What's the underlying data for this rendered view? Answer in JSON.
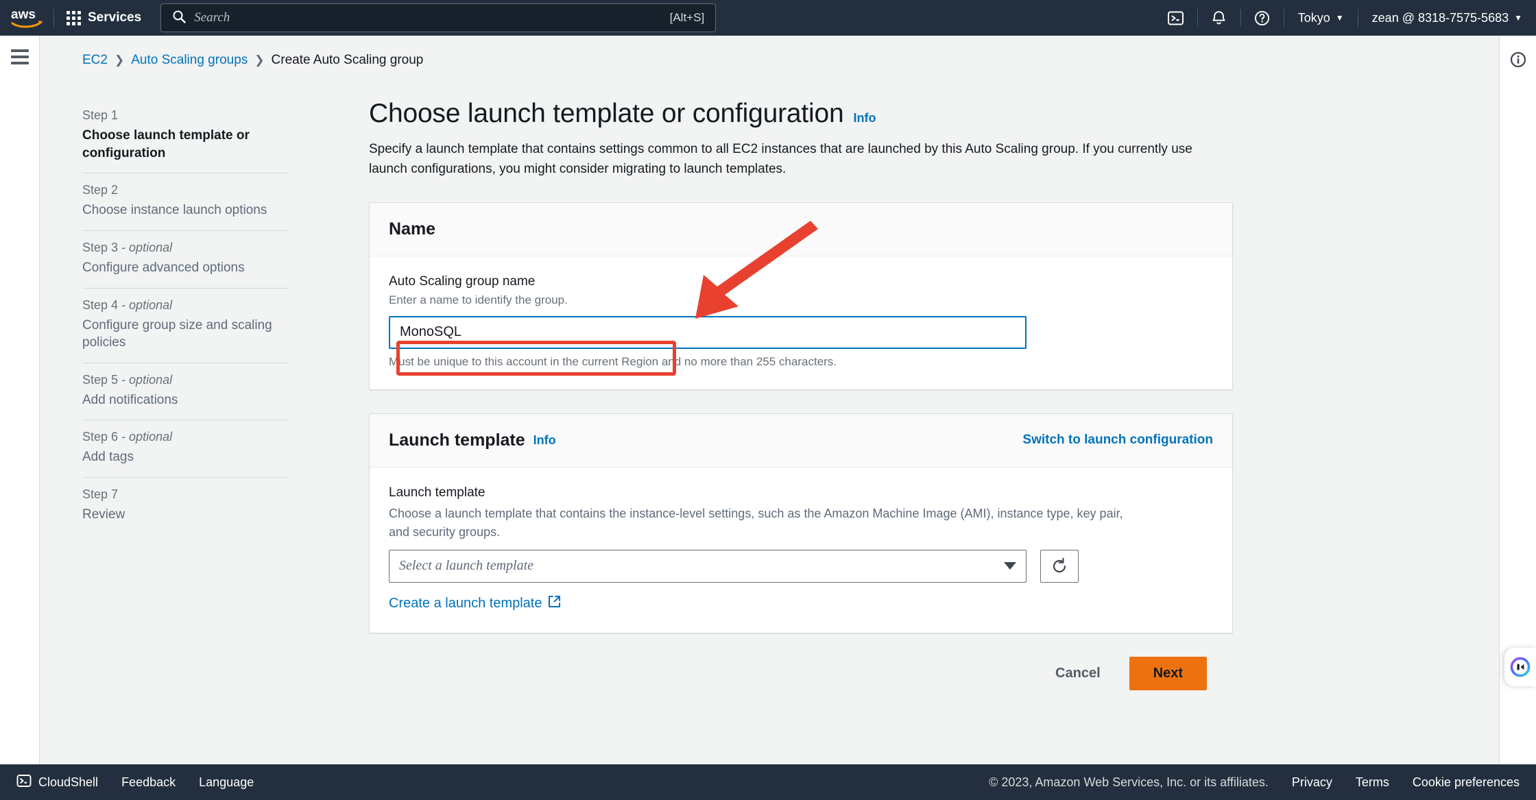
{
  "topnav": {
    "logo_alt": "aws",
    "services_label": "Services",
    "search_placeholder": "Search",
    "search_shortcut": "[Alt+S]",
    "cloudshell_icon": "cloudshell-icon",
    "bell_icon": "notifications-icon",
    "help_icon": "help-icon",
    "region_label": "Tokyo",
    "account_label": "zean @ 8318-7575-5683",
    "caret": "▼"
  },
  "breadcrumb": {
    "items": [
      {
        "label": "EC2",
        "link": true
      },
      {
        "label": "Auto Scaling groups",
        "link": true
      },
      {
        "label": "Create Auto Scaling group",
        "link": false
      }
    ],
    "separator": "❯"
  },
  "sidebar": {
    "steps": [
      {
        "num": "Step 1",
        "optional": "",
        "title": "Choose launch template or configuration",
        "active": true
      },
      {
        "num": "Step 2",
        "optional": "",
        "title": "Choose instance launch options",
        "active": false
      },
      {
        "num": "Step 3",
        "optional": " - optional",
        "title": "Configure advanced options",
        "active": false
      },
      {
        "num": "Step 4",
        "optional": " - optional",
        "title": "Configure group size and scaling policies",
        "active": false
      },
      {
        "num": "Step 5",
        "optional": " - optional",
        "title": "Add notifications",
        "active": false
      },
      {
        "num": "Step 6",
        "optional": " - optional",
        "title": "Add tags",
        "active": false
      },
      {
        "num": "Step 7",
        "optional": "",
        "title": "Review",
        "active": false
      }
    ]
  },
  "page": {
    "title": "Choose launch template or configuration",
    "info_label": "Info",
    "description": "Specify a launch template that contains settings common to all EC2 instances that are launched by this Auto Scaling group. If you currently use launch configurations, you might consider migrating to launch templates."
  },
  "name_card": {
    "header": "Name",
    "field_label": "Auto Scaling group name",
    "field_hint": "Enter a name to identify the group.",
    "input_value": "MonoSQL",
    "input_placeholder": "",
    "constraint": "Must be unique to this account in the current Region and no more than 255 characters."
  },
  "launch_template_card": {
    "header": "Launch template",
    "info_label": "Info",
    "switch_link": "Switch to launch configuration",
    "field_label": "Launch template",
    "field_desc": "Choose a launch template that contains the instance-level settings, such as the Amazon Machine Image (AMI), instance type, key pair, and security groups.",
    "select_placeholder": "Select a launch template",
    "refresh_icon": "refresh-icon",
    "create_link": "Create a launch template",
    "external_icon": "external-link-icon"
  },
  "actions": {
    "cancel_label": "Cancel",
    "next_label": "Next"
  },
  "footer": {
    "cloudshell_label": "CloudShell",
    "feedback_label": "Feedback",
    "language_label": "Language",
    "copyright": "© 2023, Amazon Web Services, Inc. or its affiliates.",
    "privacy_label": "Privacy",
    "terms_label": "Terms",
    "cookie_label": "Cookie preferences"
  },
  "right_rail": {
    "info_icon": "info-circle-icon"
  },
  "annotation": {
    "highlight_color": "#e8412f",
    "arrow_color": "#e8412f",
    "target": "Auto Scaling group name input"
  }
}
